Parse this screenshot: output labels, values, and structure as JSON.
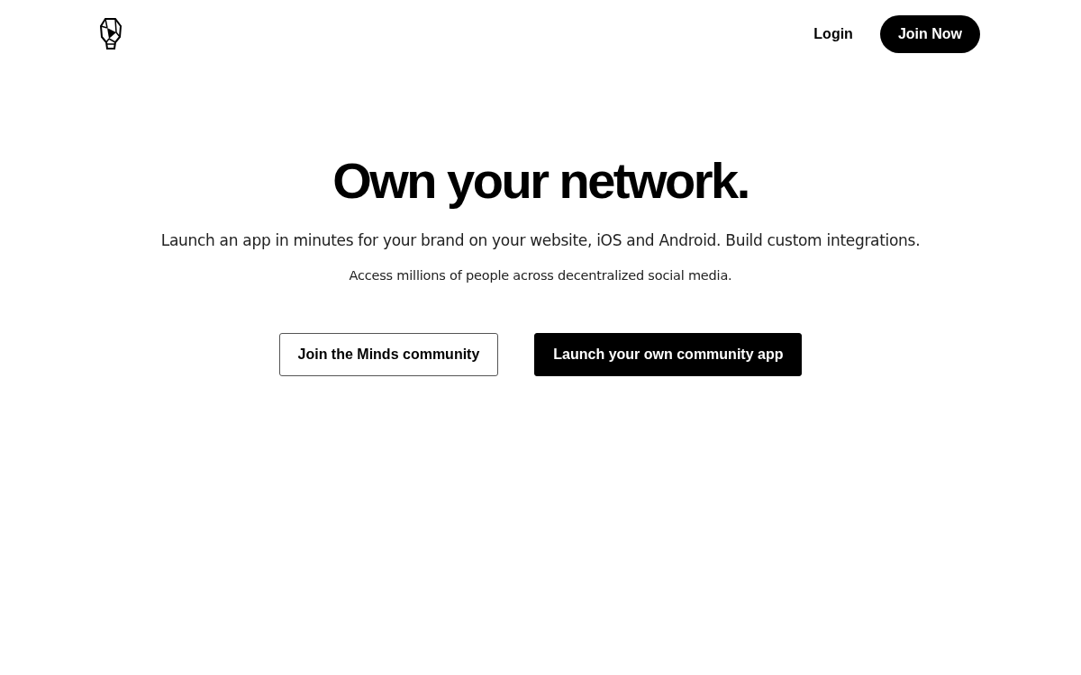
{
  "nav": {
    "login": "Login",
    "join": "Join Now"
  },
  "hero": {
    "title": "Own your network.",
    "subtitle": "Launch an app in minutes for your brand on your website, iOS and Android. Build custom integrations.",
    "note": "Access millions of people across decentralized social media.",
    "buttons": [
      {
        "label": "Join the Minds community",
        "kind": "outline"
      },
      {
        "label": "Launch your own community app",
        "kind": "solid"
      }
    ]
  }
}
